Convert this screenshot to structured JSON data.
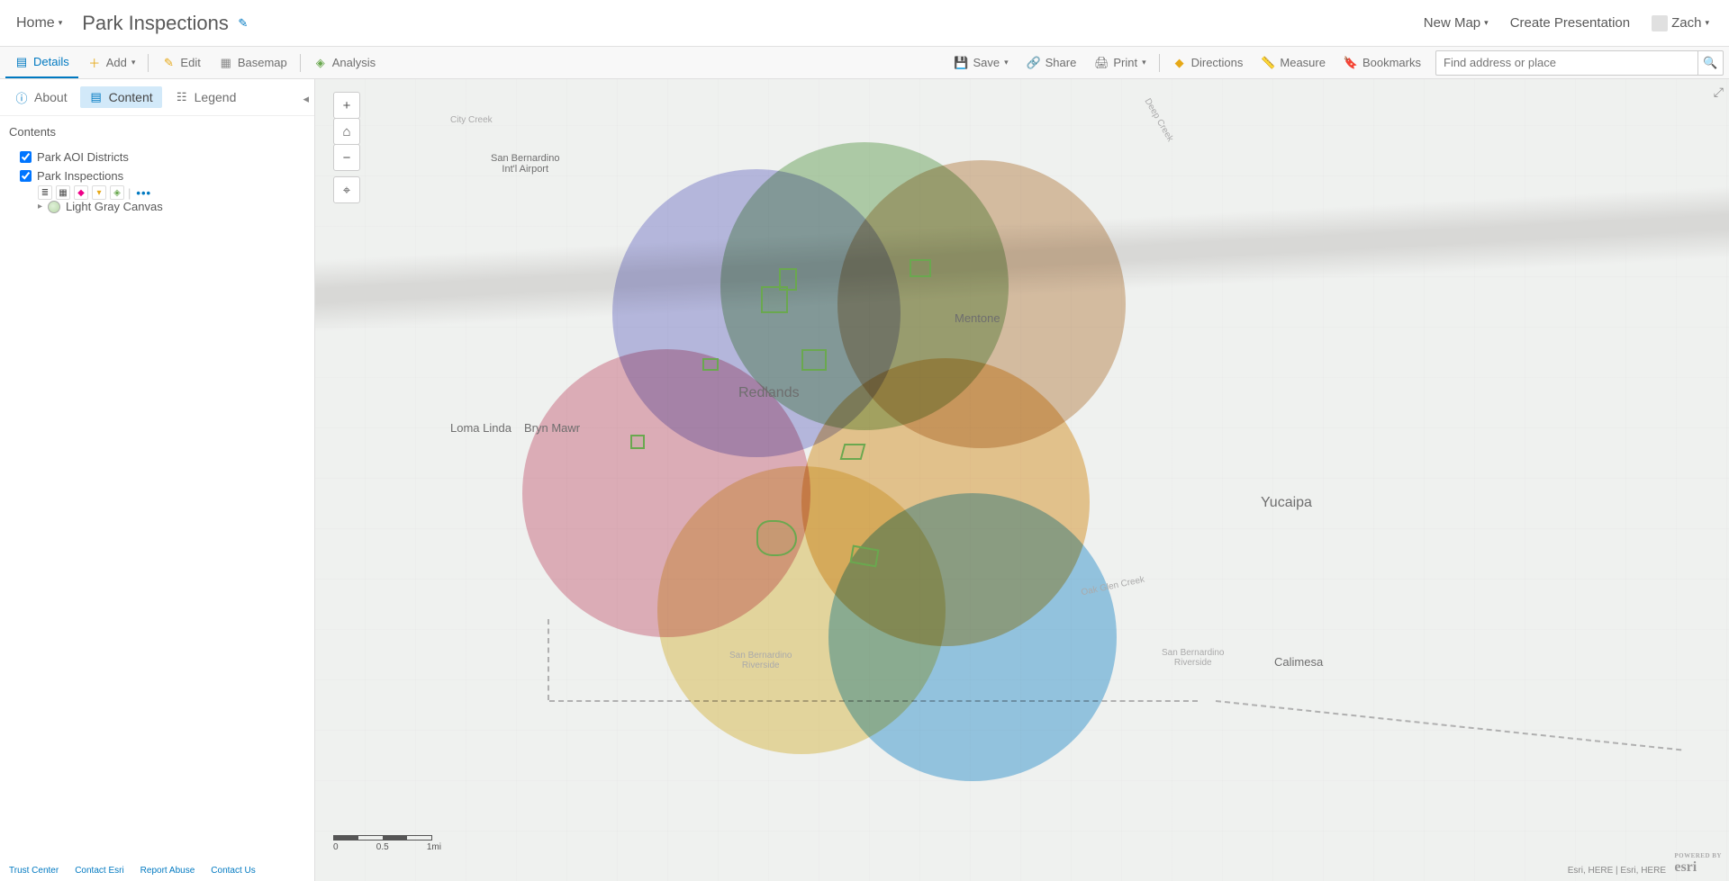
{
  "topbar": {
    "home": "Home",
    "title": "Park Inspections",
    "new_map": "New Map",
    "create_presentation": "Create Presentation",
    "user": "Zach"
  },
  "toolbar": {
    "details": "Details",
    "add": "Add",
    "edit": "Edit",
    "basemap": "Basemap",
    "analysis": "Analysis",
    "save": "Save",
    "share": "Share",
    "print": "Print",
    "directions": "Directions",
    "measure": "Measure",
    "bookmarks": "Bookmarks",
    "search_placeholder": "Find address or place"
  },
  "sidebar": {
    "tabs": {
      "about": "About",
      "content": "Content",
      "legend": "Legend"
    },
    "contents_header": "Contents",
    "layers": {
      "park_aoi": "Park AOI Districts",
      "park_inspections": "Park Inspections",
      "light_gray": "Light Gray Canvas"
    }
  },
  "footer": {
    "trust": "Trust Center",
    "contact_esri": "Contact Esri",
    "report": "Report Abuse",
    "contact_us": "Contact Us"
  },
  "map": {
    "labels": {
      "redlands": "Redlands",
      "loma_linda": "Loma Linda",
      "bryn_mawr": "Bryn Mawr",
      "mentone": "Mentone",
      "yucaipa": "Yucaipa",
      "calimesa": "Calimesa",
      "airport1": "San Bernardino",
      "airport2": "Int'l Airport",
      "city_creek": "City Creek",
      "deep_creek": "Deep Creek",
      "oak_glen": "Oak Glen Creek",
      "sb_riverside": "San Bernardino",
      "sb_riverside2": "Riverside"
    },
    "scale": {
      "a": "0",
      "b": "0.5",
      "c": "1mi"
    },
    "attribution": "Esri, HERE | Esri, HERE",
    "powered_by": "POWERED BY",
    "esri": "esri"
  },
  "chart_data": {
    "type": "map",
    "title": "Park Inspections",
    "basemap": "Light Gray Canvas",
    "center_city": "Redlands",
    "aoi_district_circles": [
      {
        "id": "A",
        "color": "#c36f8f",
        "approx_center": "west (Loma Linda / Bryn Mawr)"
      },
      {
        "id": "B",
        "color": "#7d7fd6",
        "approx_center": "northwest Redlands"
      },
      {
        "id": "C",
        "color": "#6aa84f",
        "approx_center": "north/central Redlands"
      },
      {
        "id": "D",
        "color": "#c38d5f",
        "approx_center": "northeast (Mentone)"
      },
      {
        "id": "E",
        "color": "#e6a23c",
        "approx_center": "east Redlands"
      },
      {
        "id": "F",
        "color": "#e0b94f",
        "approx_center": "south Redlands"
      },
      {
        "id": "G",
        "color": "#4a9fd8",
        "approx_center": "southeast Redlands"
      }
    ],
    "park_inspection_polygons_count": 9,
    "nearby_places": [
      "San Bernardino Int'l Airport",
      "Loma Linda",
      "Bryn Mawr",
      "Redlands",
      "Mentone",
      "Yucaipa",
      "Calimesa"
    ],
    "scale_bar": {
      "segments": [
        "0",
        "0.5",
        "1mi"
      ]
    },
    "layers_visible": {
      "Park AOI Districts": true,
      "Park Inspections": true,
      "Light Gray Canvas": true
    }
  }
}
